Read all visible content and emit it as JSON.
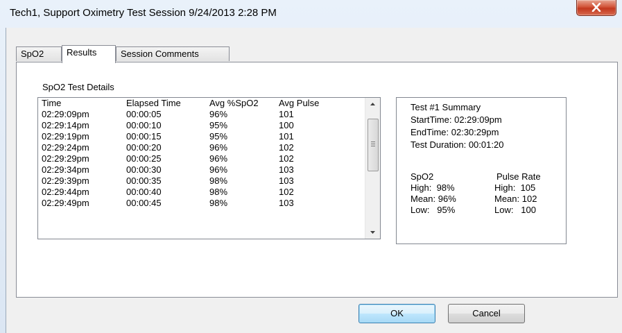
{
  "window": {
    "title": "Tech1, Support Oximetry Test Session 9/24/2013 2:28 PM"
  },
  "tabs": [
    {
      "label": "SpO2",
      "active": false
    },
    {
      "label": "Results",
      "active": true
    },
    {
      "label": "Session Comments",
      "active": false
    }
  ],
  "details": {
    "group_label": "SpO2 Test Details",
    "headers": [
      "Time",
      "Elapsed Time",
      "Avg %SpO2",
      "Avg Pulse"
    ],
    "rows": [
      [
        "02:29:09pm",
        "00:00:05",
        "96%",
        "101"
      ],
      [
        "02:29:14pm",
        "00:00:10",
        "95%",
        "100"
      ],
      [
        "02:29:19pm",
        "00:00:15",
        "95%",
        "101"
      ],
      [
        "02:29:24pm",
        "00:00:20",
        "96%",
        "102"
      ],
      [
        "02:29:29pm",
        "00:00:25",
        "96%",
        "102"
      ],
      [
        "02:29:34pm",
        "00:00:30",
        "96%",
        "103"
      ],
      [
        "02:29:39pm",
        "00:00:35",
        "98%",
        "103"
      ],
      [
        "02:29:44pm",
        "00:00:40",
        "98%",
        "102"
      ],
      [
        "02:29:49pm",
        "00:00:45",
        "98%",
        "103"
      ]
    ]
  },
  "summary": {
    "title": "Test #1 Summary",
    "start_time": "StartTime: 02:29:09pm",
    "end_time": "EndTime: 02:30:29pm",
    "duration": "Test Duration: 00:01:20",
    "spo2_heading": "SpO2",
    "spo2_high": "High:  98%",
    "spo2_mean": "Mean: 96%",
    "spo2_low": "Low:   95%",
    "pulse_heading": "Pulse Rate",
    "pulse_high": "High:  105",
    "pulse_mean": "Mean: 102",
    "pulse_low": "Low:   100"
  },
  "buttons": {
    "ok": "OK",
    "cancel": "Cancel"
  }
}
